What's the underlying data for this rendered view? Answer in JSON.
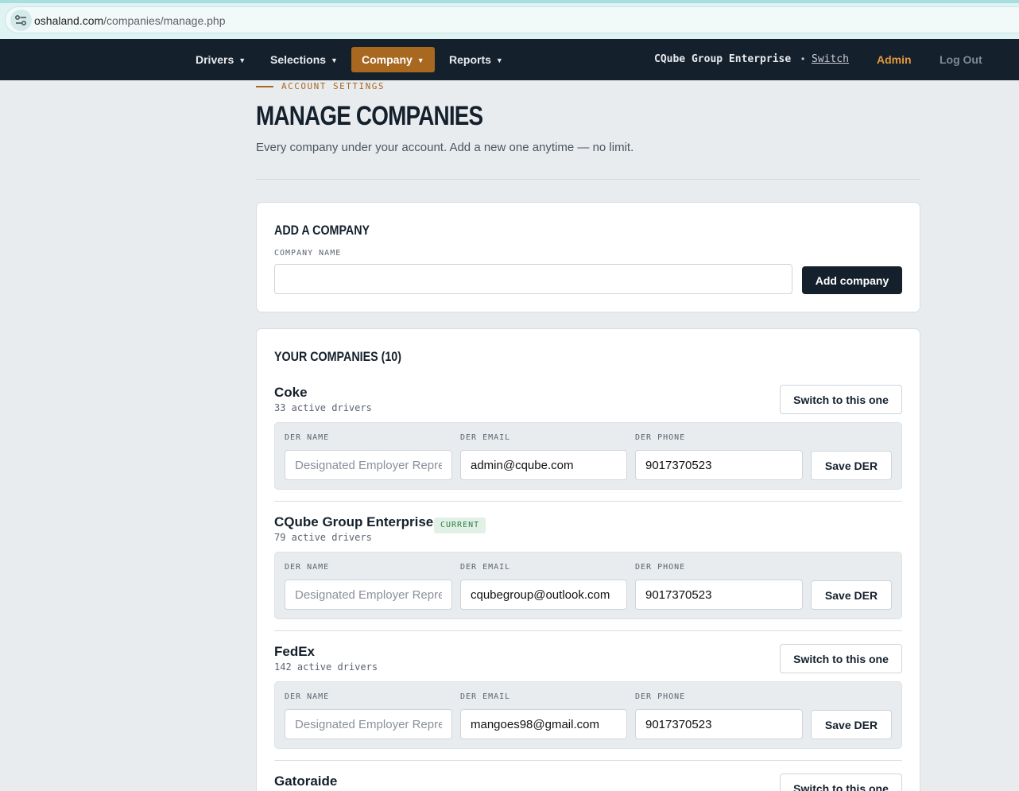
{
  "browser": {
    "url_domain": "oshaland.com",
    "url_path": "/companies/manage.php"
  },
  "nav": {
    "items": [
      {
        "label": "Drivers",
        "caret": "▼"
      },
      {
        "label": "Selections",
        "caret": "▼"
      },
      {
        "label": "Company",
        "caret": "▼",
        "active": true
      },
      {
        "label": "Reports",
        "caret": "▼"
      }
    ],
    "brand": "CQube Group Enterprise",
    "separator": "•",
    "switch_label": "Switch",
    "admin_label": "Admin",
    "logout_label": "Log Out"
  },
  "header": {
    "eyebrow": "ACCOUNT SETTINGS",
    "title": "MANAGE COMPANIES",
    "subtitle": "Every company under your account. Add a new one anytime — no limit."
  },
  "add_company": {
    "title": "ADD A COMPANY",
    "field_label": "COMPANY NAME",
    "value": "",
    "button_label": "Add company"
  },
  "companies_section": {
    "title": "YOUR COMPANIES (10)",
    "switch_label": "Switch to this one",
    "der_name_label": "DER NAME",
    "der_email_label": "DER EMAIL",
    "der_phone_label": "DER PHONE",
    "der_name_placeholder": "Designated Employer Representative",
    "save_label": "Save DER",
    "companies": [
      {
        "name": "Coke",
        "drivers": "33 active drivers",
        "der_email": "admin@cqube.com",
        "der_phone": "9017370523"
      },
      {
        "name": "CQube Group Enterprise",
        "badge": "CURRENT",
        "drivers": "79 active drivers",
        "der_email": "cqubegroup@outlook.com",
        "der_phone": "9017370523"
      },
      {
        "name": "FedEx",
        "drivers": "142 active drivers",
        "der_email": "mangoes98@gmail.com",
        "der_phone": "9017370523"
      },
      {
        "name": "Gatoraide"
      }
    ]
  },
  "colors": {
    "nav_bg": "#14202c",
    "accent": "#a8681f",
    "admin": "#e29b3c",
    "page_bg": "#e9ecef"
  }
}
